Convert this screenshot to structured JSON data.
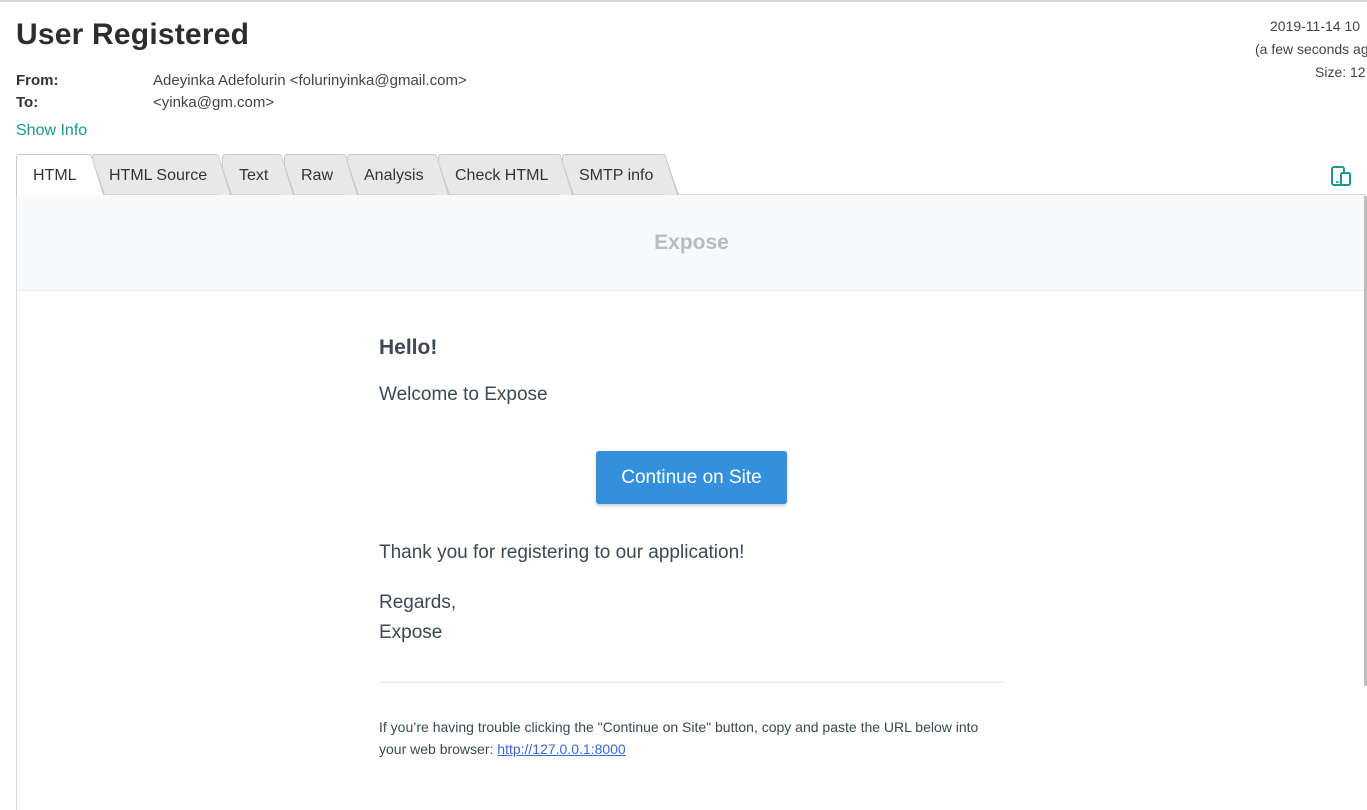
{
  "message": {
    "subject": "User Registered",
    "from_label": "From:",
    "from_value": "Adeyinka Adefolurin <folurinyinka@gmail.com>",
    "to_label": "To:",
    "to_value": "<yinka@gm.com>",
    "show_info": "Show Info",
    "date": "2019-11-14 10",
    "relative_time": "(a few seconds ag",
    "size": "Size: 12"
  },
  "tabs": [
    {
      "label": "HTML",
      "active": true
    },
    {
      "label": "HTML Source"
    },
    {
      "label": "Text"
    },
    {
      "label": "Raw"
    },
    {
      "label": "Analysis"
    },
    {
      "label": "Check HTML"
    },
    {
      "label": "SMTP info"
    }
  ],
  "toolbar": {
    "device_icon": "responsive-devices-icon"
  },
  "email": {
    "brand": "Expose",
    "greeting": "Hello!",
    "intro": "Welcome to Expose",
    "button_label": "Continue on Site",
    "outro": "Thank you for registering to our application!",
    "regards": "Regards,",
    "signature": "Expose",
    "subcopy_text": "If you’re having trouble clicking the \"Continue on Site\" button, copy and paste the URL below into your web browser: ",
    "subcopy_link": "http://127.0.0.1:8000"
  },
  "colors": {
    "accent_link": "#1a9a8a",
    "button": "#3490dc",
    "body_text": "#3d4852"
  }
}
